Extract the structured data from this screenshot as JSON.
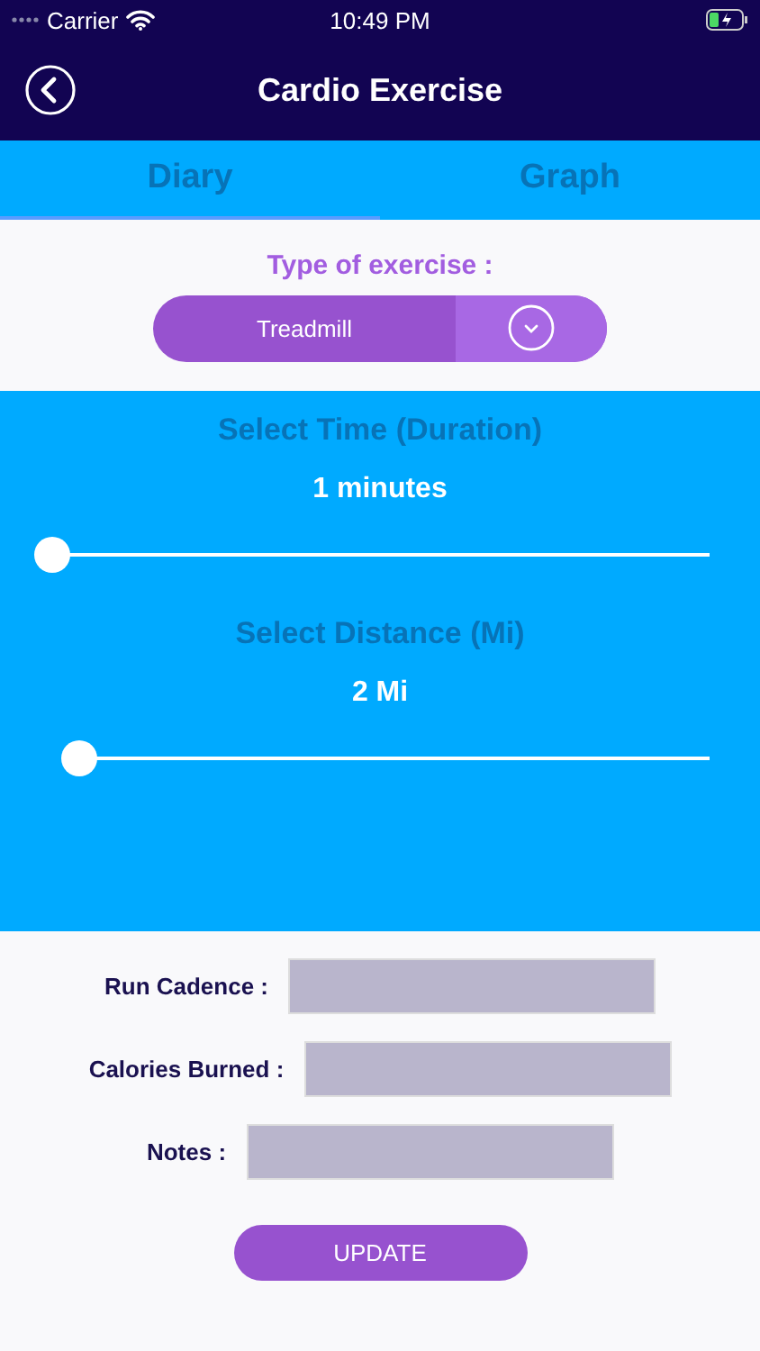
{
  "status_bar": {
    "carrier": "Carrier",
    "time": "10:49 PM"
  },
  "nav": {
    "title": "Cardio Exercise"
  },
  "tabs": [
    {
      "label": "Diary",
      "selected": true
    },
    {
      "label": "Graph",
      "selected": false
    }
  ],
  "exercise_type": {
    "label": "Type of exercise :",
    "value": "Treadmill"
  },
  "sliders": [
    {
      "title": "Select Time (Duration)",
      "reading": "1  minutes",
      "level": 0
    },
    {
      "title": "Select Distance (Mi)",
      "reading": "2 Mi",
      "level": 0.02
    }
  ],
  "fields": [
    {
      "label": "Run Cadence :"
    },
    {
      "label": "Calories Burned :"
    },
    {
      "label": "Notes :"
    }
  ],
  "button": "UPDATE"
}
